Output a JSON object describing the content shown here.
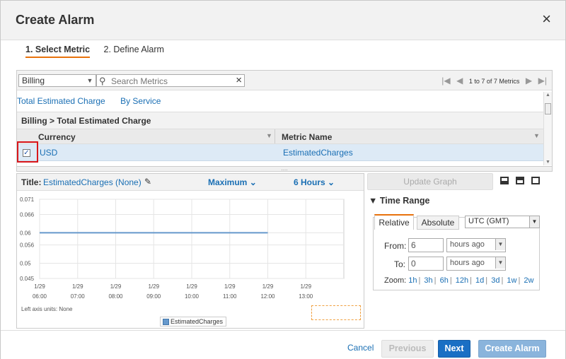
{
  "dialog": {
    "title": "Create Alarm",
    "close_icon": "×",
    "steps": [
      "1. Select Metric",
      "2. Define Alarm"
    ]
  },
  "filter": {
    "namespace": "Billing",
    "search_placeholder": "Search Metrics",
    "clear_icon": "×",
    "pager_text": "1 to 7 of 7 Metrics"
  },
  "metric_tabs": [
    "Total Estimated Charge",
    "By Service"
  ],
  "breadcrumb": "Billing > Total Estimated Charge",
  "table": {
    "columns": [
      "Currency",
      "Metric Name"
    ],
    "rows": [
      {
        "currency": "USD",
        "metric_name": "EstimatedCharges",
        "checked": true
      }
    ]
  },
  "graph": {
    "title_label": "Title:",
    "title_value": "EstimatedCharges (None)",
    "statistic": "Maximum",
    "period": "6 Hours",
    "left_axis_units": "Left axis units: None",
    "legend": "EstimatedCharges"
  },
  "chart_data": {
    "type": "line",
    "x_ticks": [
      [
        "1/29",
        "06:00"
      ],
      [
        "1/29",
        "07:00"
      ],
      [
        "1/29",
        "08:00"
      ],
      [
        "1/29",
        "09:00"
      ],
      [
        "1/29",
        "10:00"
      ],
      [
        "1/29",
        "11:00"
      ],
      [
        "1/29",
        "12:00"
      ],
      [
        "1/29",
        "13:00"
      ]
    ],
    "y_ticks": [
      "0.071",
      "0.066",
      "0.06",
      "0.056",
      "0.05",
      "0.045"
    ],
    "ylim": [
      0.045,
      0.071
    ],
    "series": [
      {
        "name": "EstimatedCharges",
        "x_range": [
          "06:00",
          "12:00"
        ],
        "values": [
          0.06,
          0.06,
          0.06,
          0.06,
          0.06,
          0.06,
          0.06
        ]
      }
    ],
    "grid": true,
    "line_color": "#6699cc"
  },
  "right_panel": {
    "update_graph": "Update Graph",
    "time_range": "Time Range",
    "tab_relative": "Relative",
    "tab_absolute": "Absolute",
    "timezone": "UTC (GMT)",
    "from_label": "From:",
    "from_value": "6",
    "from_unit": "hours ago",
    "to_label": "To:",
    "to_value": "0",
    "to_unit": "hours ago",
    "zoom_label": "Zoom:",
    "zoom_options": [
      "1h",
      "3h",
      "6h",
      "12h",
      "1d",
      "3d",
      "1w",
      "2w"
    ]
  },
  "footer": {
    "cancel": "Cancel",
    "previous": "Previous",
    "next": "Next",
    "create_alarm": "Create Alarm"
  }
}
